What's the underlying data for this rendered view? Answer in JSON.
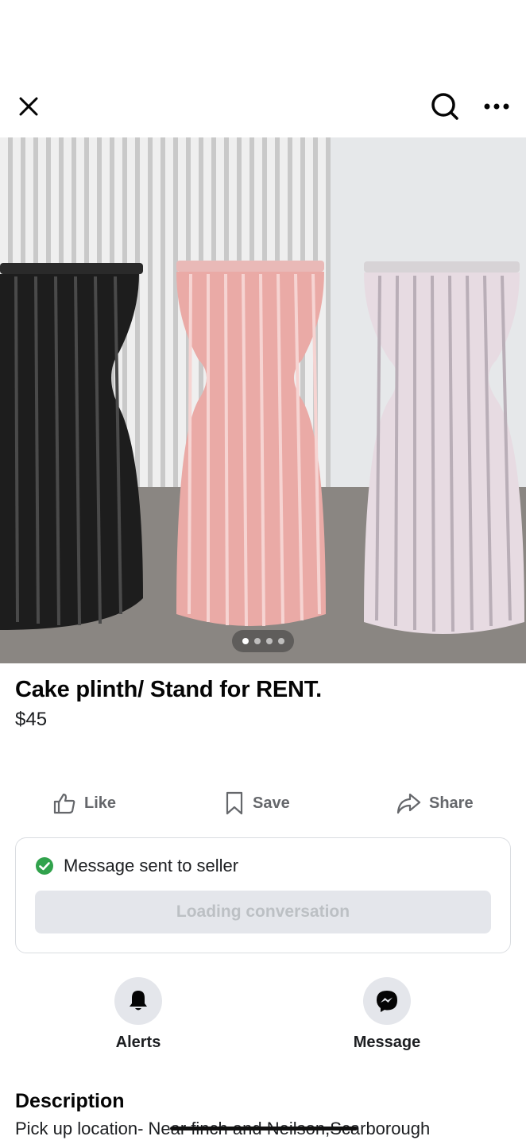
{
  "header": {
    "close_icon": "close-icon",
    "search_icon": "search-icon",
    "more_icon": "more-horizontal-icon"
  },
  "listing": {
    "title": "Cake plinth/ Stand for RENT.",
    "price": "$45",
    "image": {
      "description_icon": "product-photo",
      "current_slide": 1,
      "slide_count": 4
    }
  },
  "actions": {
    "like_label": "Like",
    "save_label": "Save",
    "share_label": "Share"
  },
  "message_card": {
    "status_text": "Message sent to seller",
    "status_color": "#31a24c",
    "button_label": "Loading conversation"
  },
  "quick_actions": {
    "alerts_label": "Alerts",
    "message_label": "Message"
  },
  "description": {
    "heading": "Description",
    "text": "Pick up location- Near finch and Neilson,Scarborough"
  }
}
